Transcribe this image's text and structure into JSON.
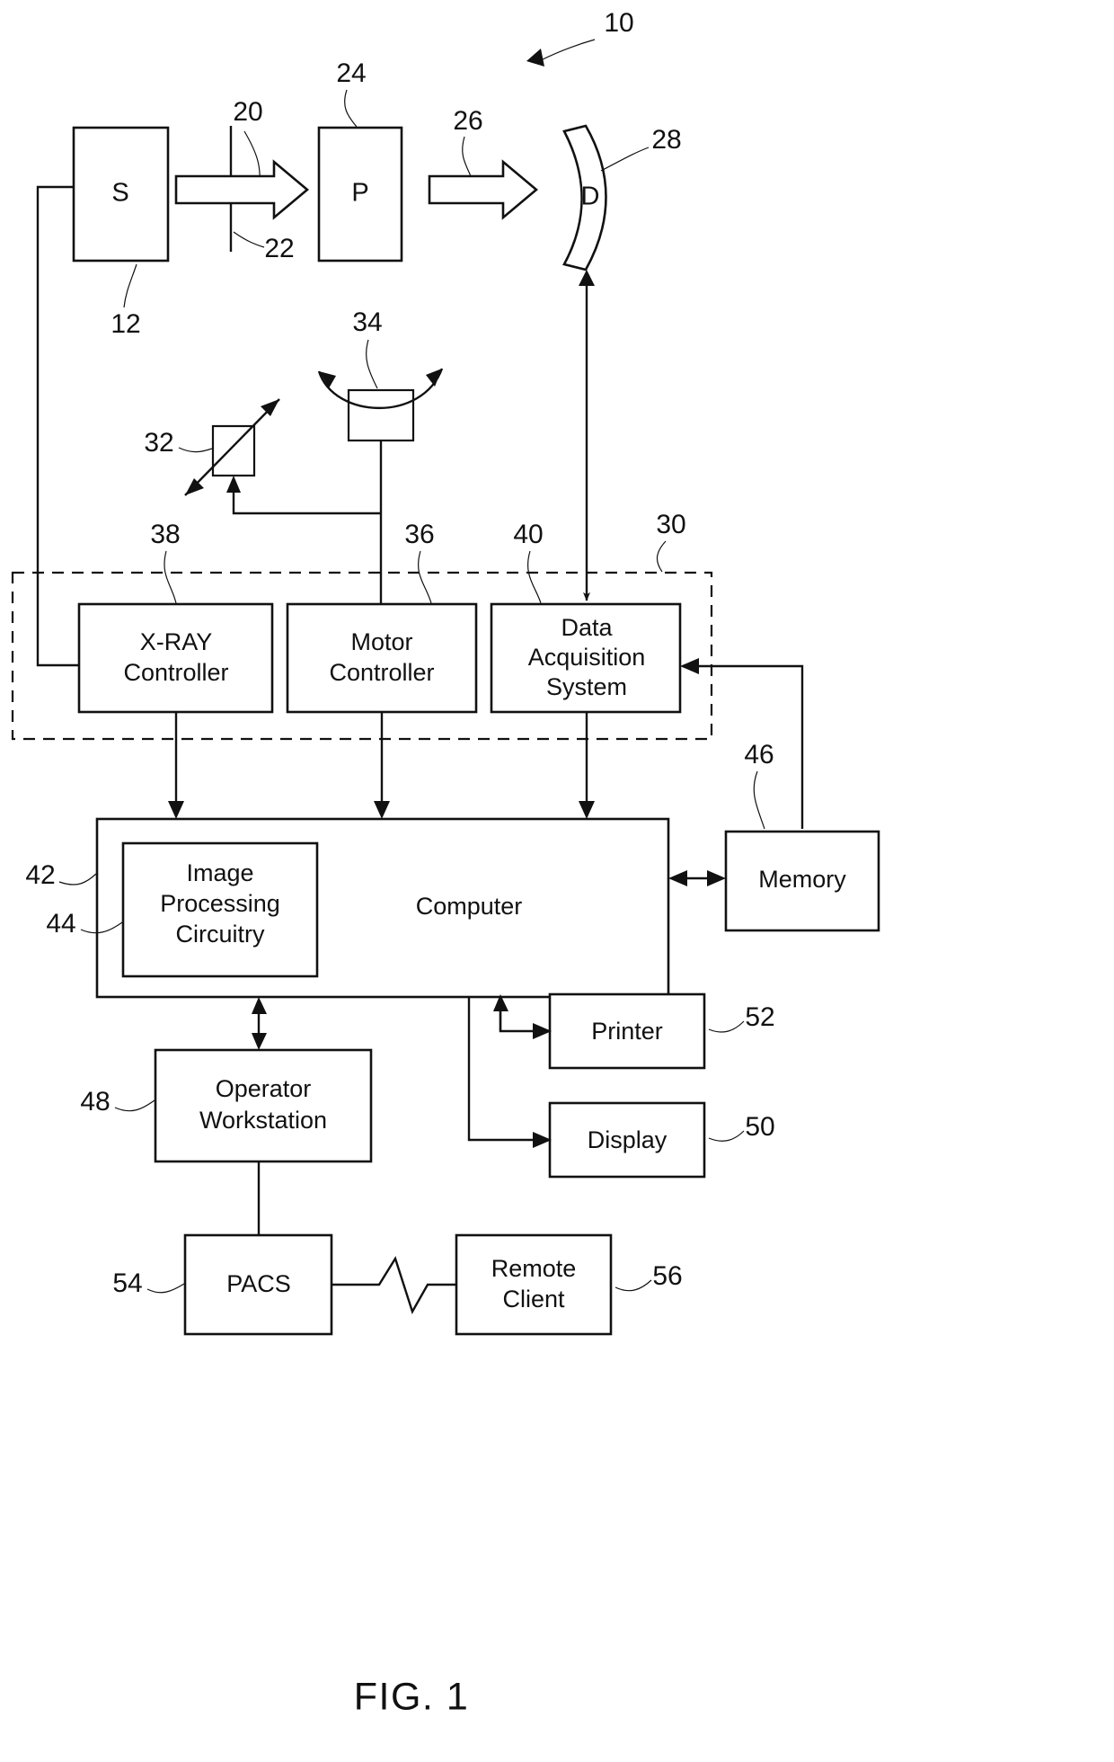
{
  "figure": {
    "caption": "FIG. 1",
    "title_ref": "10"
  },
  "nodes": {
    "source": {
      "label": "S",
      "ref": "12"
    },
    "collimator": {
      "ref_upper": "20",
      "ref_lower": "22"
    },
    "patient": {
      "label": "P",
      "ref": "24"
    },
    "beam_attenuated": {
      "ref": "26"
    },
    "detector": {
      "label": "D",
      "ref": "28"
    },
    "linear_positioner": {
      "ref": "32"
    },
    "rotational_positioner": {
      "ref": "34"
    },
    "system_controller": {
      "ref": "30"
    },
    "xray_controller": {
      "line1": "X-RAY",
      "line2": "Controller",
      "ref": "38"
    },
    "motor_controller": {
      "line1": "Motor",
      "line2": "Controller",
      "ref": "36"
    },
    "data_acquisition": {
      "line1": "Data",
      "line2": "Acquisition",
      "line3": "System",
      "ref": "40"
    },
    "computer": {
      "label": "Computer",
      "ref": "42"
    },
    "image_processing": {
      "line1": "Image",
      "line2": "Processing",
      "line3": "Circuitry",
      "ref": "44"
    },
    "memory": {
      "label": "Memory",
      "ref": "46"
    },
    "printer": {
      "label": "Printer",
      "ref": "52"
    },
    "display": {
      "label": "Display",
      "ref": "50"
    },
    "operator_workstation": {
      "line1": "Operator",
      "line2": "Workstation",
      "ref": "48"
    },
    "pacs": {
      "label": "PACS",
      "ref": "54"
    },
    "remote_client": {
      "line1": "Remote",
      "line2": "Client",
      "ref": "56"
    }
  },
  "chart_data": {
    "type": "diagram",
    "title": "FIG. 1",
    "description": "Block diagram of an x-ray imaging system",
    "blocks": [
      {
        "id": "12",
        "label": "S",
        "role": "x-ray source"
      },
      {
        "id": "24",
        "label": "P",
        "role": "patient"
      },
      {
        "id": "28",
        "label": "D",
        "role": "detector"
      },
      {
        "id": "32",
        "label": "",
        "role": "linear positioner"
      },
      {
        "id": "34",
        "label": "",
        "role": "rotational positioner"
      },
      {
        "id": "38",
        "label": "X-RAY Controller",
        "role": "controller"
      },
      {
        "id": "36",
        "label": "Motor Controller",
        "role": "controller"
      },
      {
        "id": "40",
        "label": "Data Acquisition System",
        "role": "controller"
      },
      {
        "id": "30",
        "label": "",
        "role": "system controller enclosure"
      },
      {
        "id": "42",
        "label": "Computer",
        "role": "processing"
      },
      {
        "id": "44",
        "label": "Image Processing Circuitry",
        "role": "processing"
      },
      {
        "id": "46",
        "label": "Memory",
        "role": "storage"
      },
      {
        "id": "48",
        "label": "Operator Workstation",
        "role": "interface"
      },
      {
        "id": "50",
        "label": "Display",
        "role": "output"
      },
      {
        "id": "52",
        "label": "Printer",
        "role": "output"
      },
      {
        "id": "54",
        "label": "PACS",
        "role": "archive"
      },
      {
        "id": "56",
        "label": "Remote Client",
        "role": "remote"
      }
    ],
    "edges": [
      {
        "from": "12",
        "to": "24",
        "style": "hollow-arrow",
        "ref": "20"
      },
      {
        "from": "24",
        "to": "28",
        "style": "hollow-arrow",
        "ref": "26"
      },
      {
        "from": "28",
        "to": "40",
        "style": "arrow"
      },
      {
        "from": "38",
        "to": "12",
        "style": "line"
      },
      {
        "from": "36",
        "to": "32",
        "style": "arrow"
      },
      {
        "from": "36",
        "to": "34",
        "style": "line"
      },
      {
        "from": "38",
        "to": "42",
        "style": "arrow"
      },
      {
        "from": "36",
        "to": "42",
        "style": "arrow"
      },
      {
        "from": "40",
        "to": "42",
        "style": "arrow"
      },
      {
        "from": "42",
        "to": "46",
        "style": "double-arrow"
      },
      {
        "from": "46",
        "to": "40",
        "style": "arrow"
      },
      {
        "from": "42",
        "to": "48",
        "style": "double-arrow"
      },
      {
        "from": "42",
        "to": "52",
        "style": "arrow"
      },
      {
        "from": "42",
        "to": "50",
        "style": "arrow"
      },
      {
        "from": "48",
        "to": "54",
        "style": "line"
      },
      {
        "from": "54",
        "to": "56",
        "style": "network-line"
      }
    ]
  }
}
